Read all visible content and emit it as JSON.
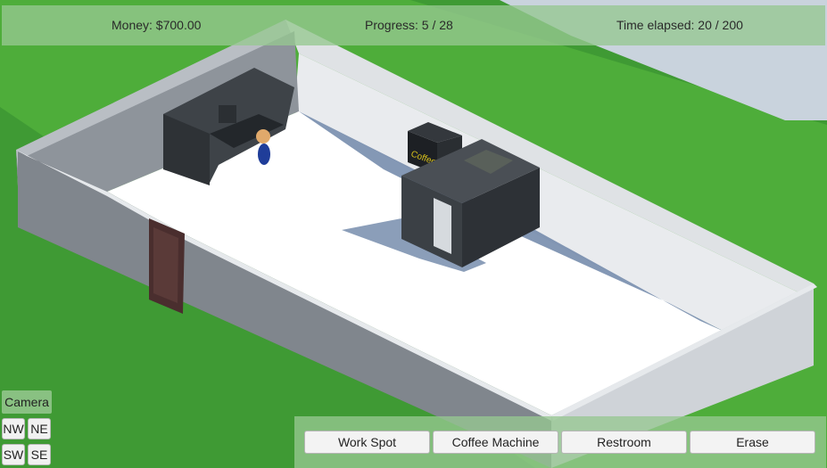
{
  "hud": {
    "money": "Money: $700.00",
    "progress": "Progress: 5 / 28",
    "time": "Time elapsed: 20 / 200"
  },
  "camera": {
    "label": "Camera",
    "buttons": [
      "NW",
      "NE",
      "SW",
      "SE"
    ]
  },
  "toolbar": {
    "buttons": [
      "Work Spot",
      "Coffee Machine",
      "Restroom",
      "Erase"
    ]
  },
  "scene": {
    "coffee_sign": "Coffee",
    "colors": {
      "grass": "#3f9a34",
      "sky": "#c9d3dd",
      "wall": "#cfd3d8",
      "floor": "#ffffff",
      "furniture": "#4a4f55"
    }
  }
}
